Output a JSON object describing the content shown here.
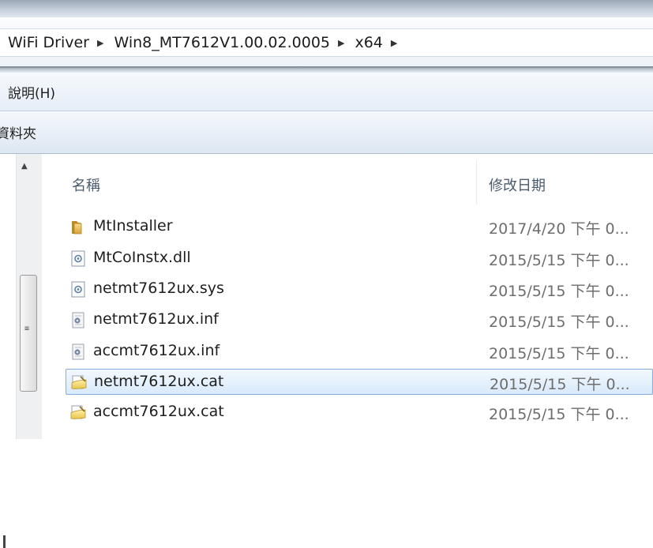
{
  "address": {
    "crumbs": [
      "WiFi Driver",
      "Win8_MT7612V1.00.02.0005",
      "x64"
    ]
  },
  "menu": {
    "help": "說明(H)"
  },
  "commandbar": {
    "label": "資料夾"
  },
  "columns": {
    "name": "名稱",
    "date_modified": "修改日期"
  },
  "files": [
    {
      "name": "MtInstaller",
      "date": "2017/4/20 下午 0...",
      "icon": "folder-icon"
    },
    {
      "name": "MtCoInstx.dll",
      "date": "2015/5/15 下午 0...",
      "icon": "dll-file-icon"
    },
    {
      "name": "netmt7612ux.sys",
      "date": "2015/5/15 下午 0...",
      "icon": "sys-file-icon"
    },
    {
      "name": "netmt7612ux.inf",
      "date": "2015/5/15 下午 0...",
      "icon": "inf-file-icon"
    },
    {
      "name": "accmt7612ux.inf",
      "date": "2015/5/15 下午 0...",
      "icon": "inf-file-icon"
    },
    {
      "name": "netmt7612ux.cat",
      "date": "2015/5/15 下午 0...",
      "icon": "cat-file-icon",
      "selected": true
    },
    {
      "name": "accmt7612ux.cat",
      "date": "2015/5/15 下午 0...",
      "icon": "cat-file-icon"
    }
  ],
  "colors": {
    "selection_border": "#84acdd",
    "folder": "#e8b84a"
  }
}
